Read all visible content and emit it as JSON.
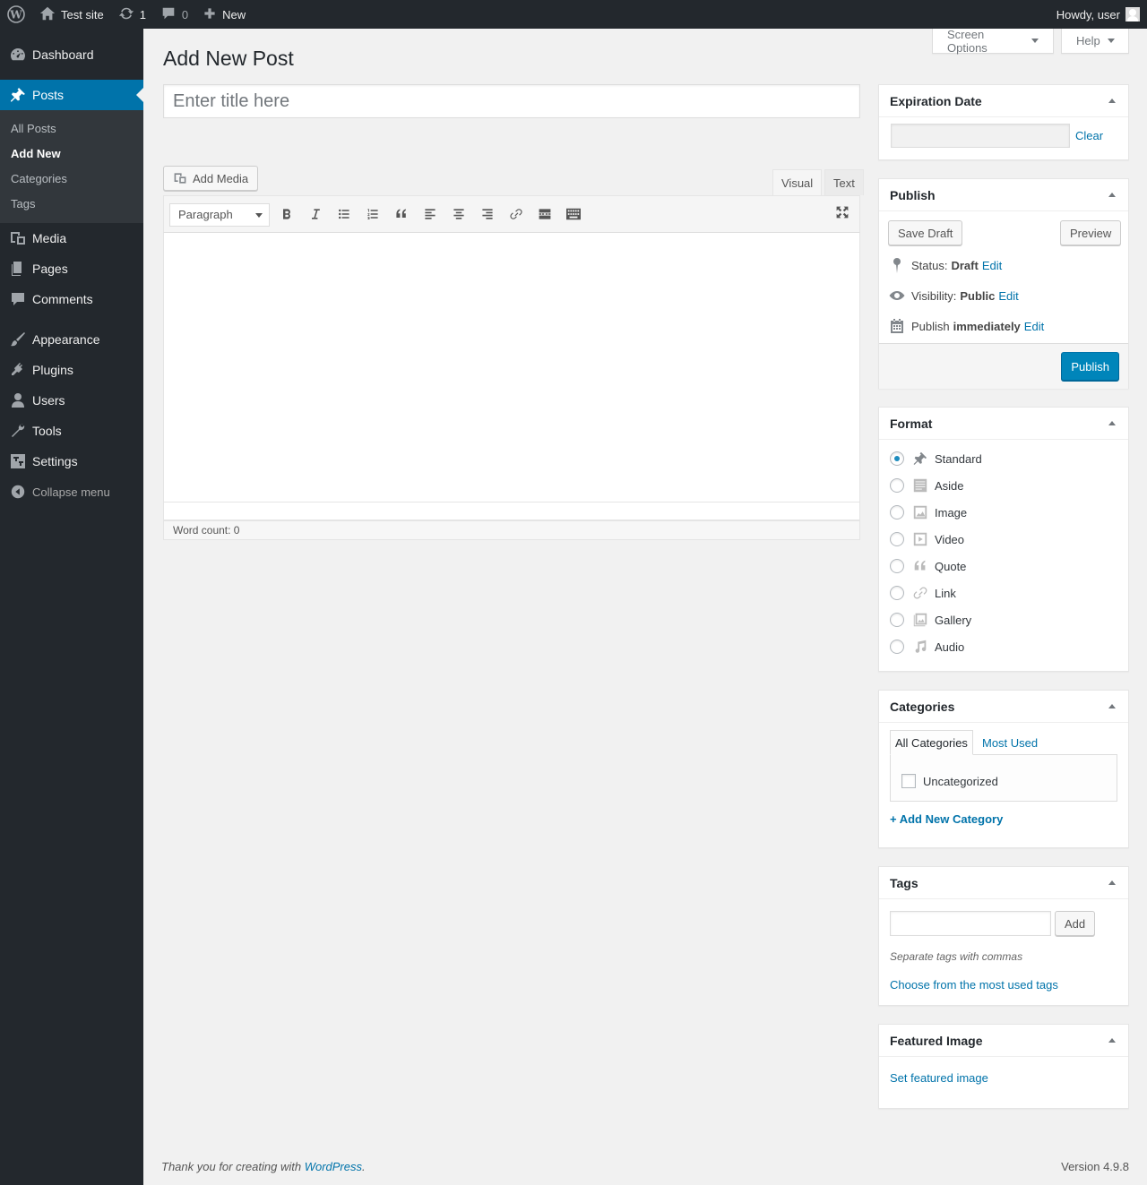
{
  "adminbar": {
    "site_name": "Test site",
    "updates_count": "1",
    "comments_count": "0",
    "new_label": "New",
    "howdy": "Howdy, user"
  },
  "menu": {
    "dashboard": "Dashboard",
    "posts": "Posts",
    "posts_sub": [
      "All Posts",
      "Add New",
      "Categories",
      "Tags"
    ],
    "media": "Media",
    "pages": "Pages",
    "comments": "Comments",
    "appearance": "Appearance",
    "plugins": "Plugins",
    "users": "Users",
    "tools": "Tools",
    "settings": "Settings",
    "collapse": "Collapse menu"
  },
  "screen_meta": {
    "screen_options": "Screen Options",
    "help": "Help"
  },
  "page": {
    "heading": "Add New Post",
    "title_placeholder": "Enter title here"
  },
  "editor": {
    "add_media": "Add Media",
    "tab_visual": "Visual",
    "tab_text": "Text",
    "format_select": "Paragraph",
    "word_count": "Word count: 0"
  },
  "expiration": {
    "title": "Expiration Date",
    "clear": "Clear"
  },
  "publish": {
    "title": "Publish",
    "save_draft": "Save Draft",
    "preview": "Preview",
    "status_label": "Status:",
    "status_value": "Draft",
    "visibility_label": "Visibility:",
    "visibility_value": "Public",
    "publish_label": "Publish",
    "publish_value": "immediately",
    "edit": "Edit",
    "publish_button": "Publish",
    "accent_color": "#0085ba"
  },
  "format": {
    "title": "Format",
    "options": [
      "Standard",
      "Aside",
      "Image",
      "Video",
      "Quote",
      "Link",
      "Gallery",
      "Audio"
    ],
    "selected": "Standard"
  },
  "categories": {
    "title": "Categories",
    "tab_all": "All Categories",
    "tab_most_used": "Most Used",
    "items": [
      "Uncategorized"
    ],
    "add_new": "+ Add New Category"
  },
  "tags": {
    "title": "Tags",
    "add_button": "Add",
    "hint": "Separate tags with commas",
    "choose_link": "Choose from the most used tags"
  },
  "featured_image": {
    "title": "Featured Image",
    "set_link": "Set featured image"
  },
  "footer": {
    "thanks_prefix": "Thank you for creating with",
    "wordpress_link": "WordPress",
    "thanks_suffix": ".",
    "version": "Version 4.9.8"
  }
}
